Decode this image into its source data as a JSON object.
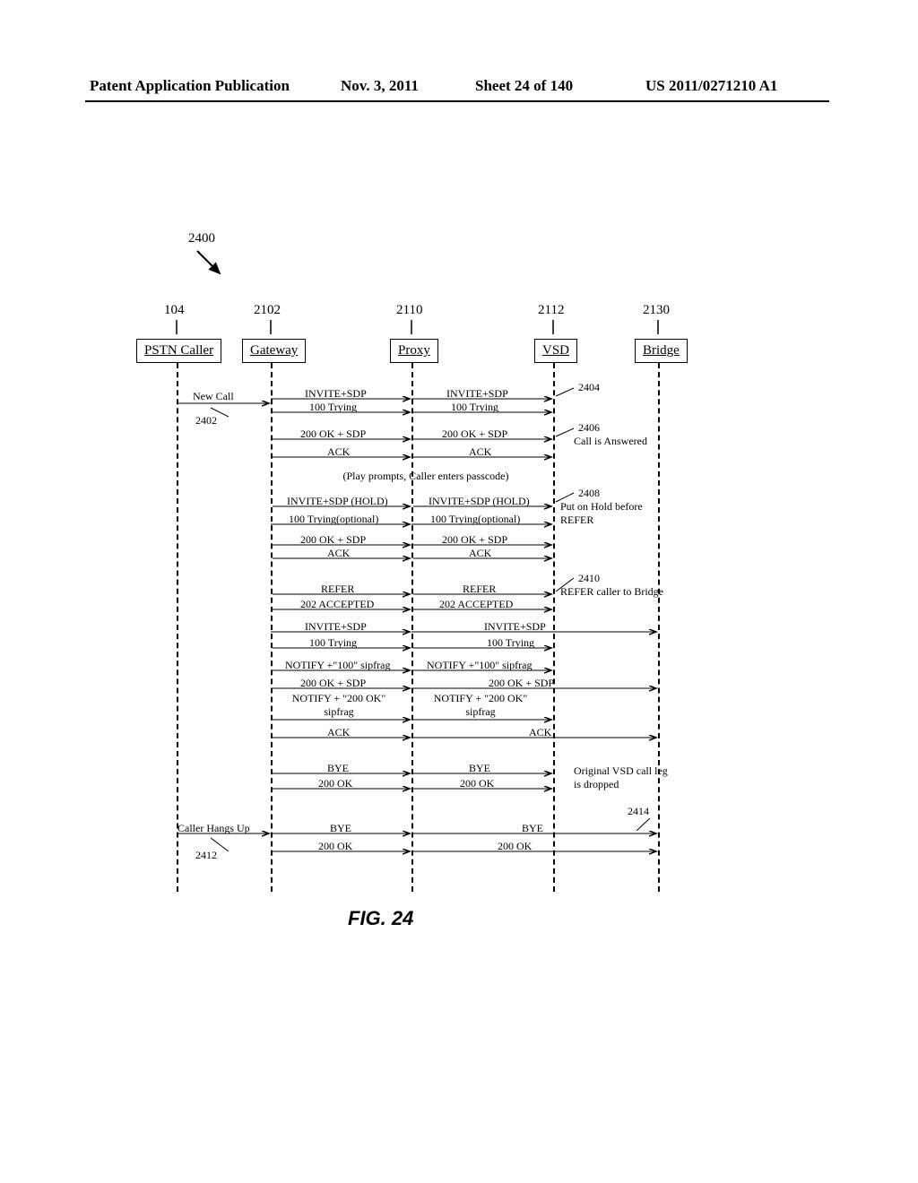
{
  "header": {
    "pub": "Patent Application Publication",
    "date": "Nov. 3, 2011",
    "sheet": "Sheet 24 of 140",
    "num": "US 2011/0271210 A1"
  },
  "diagram_ref": "2400",
  "nodes": {
    "n0": {
      "num": "104",
      "label": "PSTN Caller"
    },
    "n1": {
      "num": "2102",
      "label": "Gateway"
    },
    "n2": {
      "num": "2110",
      "label": "Proxy"
    },
    "n3": {
      "num": "2112",
      "label": "VSD"
    },
    "n4": {
      "num": "2130",
      "label": "Bridge"
    }
  },
  "events": {
    "new_call": "New Call",
    "e2402": "2402",
    "caller_hangs": "Caller Hangs Up",
    "e2412": "2412"
  },
  "annot": {
    "a2404": "2404",
    "a2406": "2406",
    "a2406txt": "Call is Answered",
    "a_prompts": "(Play prompts, Caller enters passcode)",
    "a2408": "2408",
    "a2408txt": "Put on Hold before REFER",
    "a2410": "2410",
    "a2410txt": "REFER caller to Bridge",
    "a_vsd_drop": "Original VSD call leg is dropped",
    "a2414": "2414"
  },
  "msgs": {
    "invite_sdp": "INVITE+SDP",
    "trying100": "100 Trying",
    "ok200_sdp": "200 OK + SDP",
    "ack": "ACK",
    "invite_sdp_hold": "INVITE+SDP (HOLD)",
    "trying100_opt": "100 Trying(optional)",
    "refer": "REFER",
    "acc202": "202 ACCEPTED",
    "notify100": "NOTIFY +\"100\" sipfrag",
    "notify200": "NOTIFY + \"200 OK\" sipfrag",
    "bye": "BYE",
    "ok200": "200 OK"
  },
  "caption": "FIG. 24"
}
